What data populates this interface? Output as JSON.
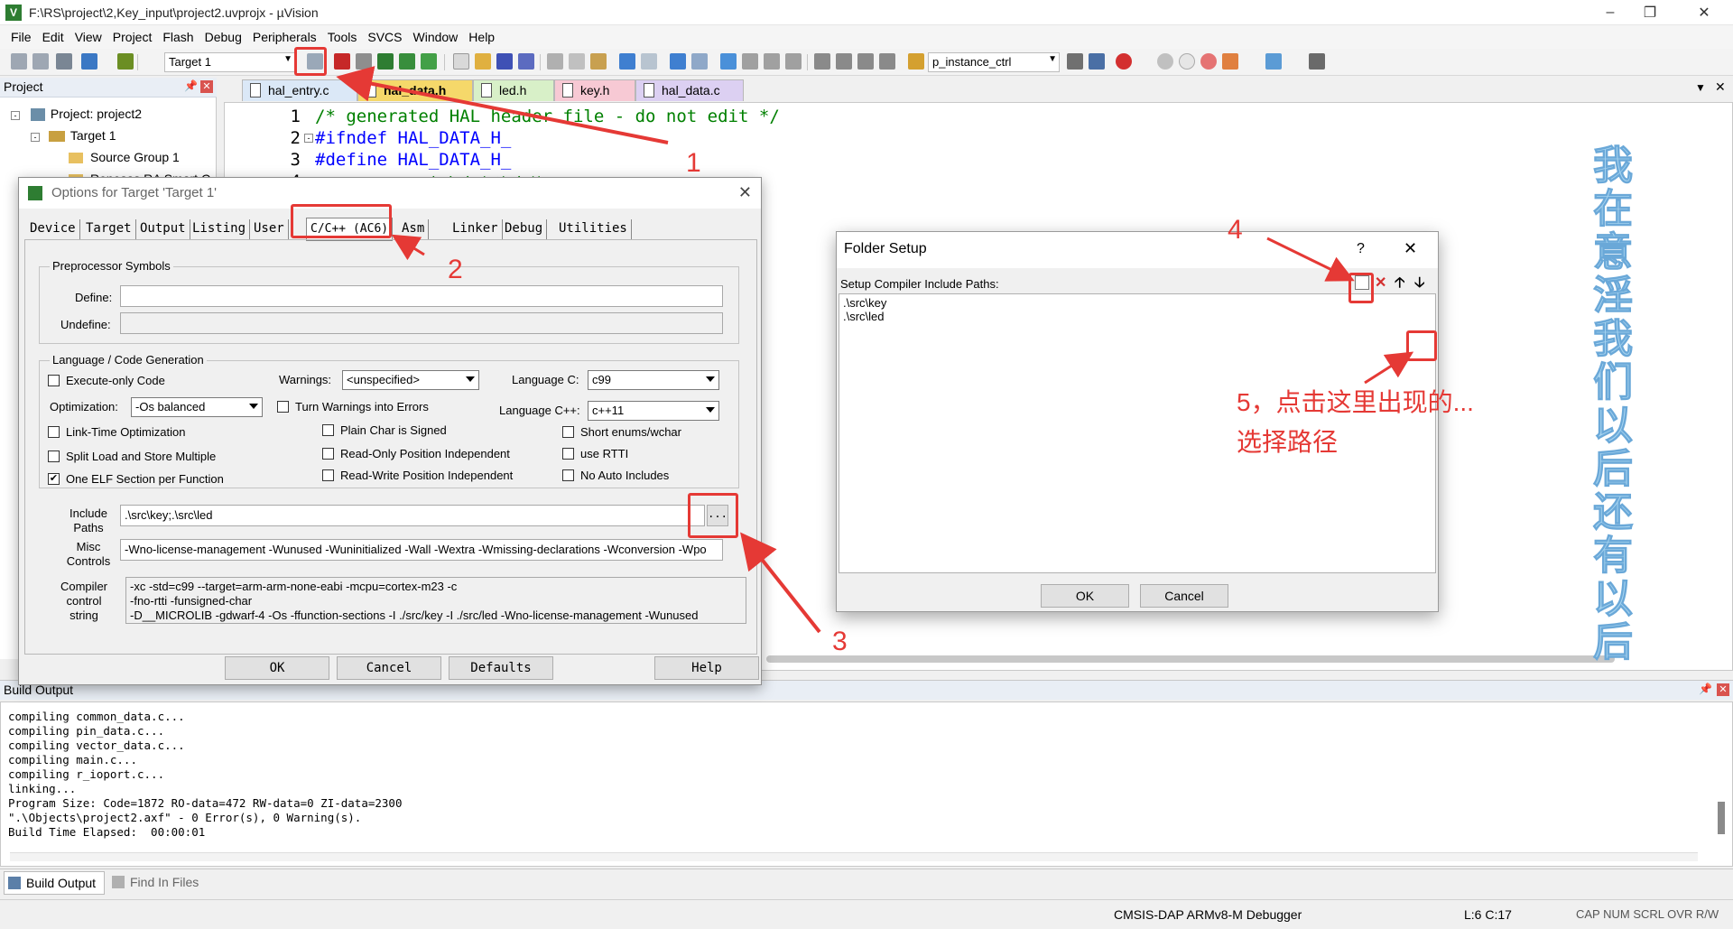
{
  "window": {
    "title": "F:\\RS\\project\\2,Key_input\\project2.uvprojx - µVision"
  },
  "menu": [
    "File",
    "Edit",
    "View",
    "Project",
    "Flash",
    "Debug",
    "Peripherals",
    "Tools",
    "SVCS",
    "Window",
    "Help"
  ],
  "toolbar": {
    "target": "Target 1",
    "function": "p_instance_ctrl"
  },
  "project_panel": {
    "header": "Project",
    "tree": [
      "Project: project2",
      "Target 1",
      "Source Group 1",
      "Renesas RA Smart C"
    ]
  },
  "editor": {
    "tabs": [
      "hal_entry.c",
      "hal_data.h",
      "led.h",
      "key.h",
      "hal_data.c"
    ],
    "lines": [
      {
        "n": "1",
        "text": "/* generated HAL header file - do not edit */"
      },
      {
        "n": "2",
        "text": "#ifndef HAL_DATA_H_"
      },
      {
        "n": "3",
        "text": "#define HAL_DATA_H_"
      },
      {
        "n": "4",
        "text": "/*****   用户自定义头文件      *****/"
      }
    ],
    "side_text": "我在意淫我们以后还有以后"
  },
  "options_dialog": {
    "title": "Options for Target 'Target 1'",
    "tabs": [
      "Device",
      "Target",
      "Output",
      "Listing",
      "User",
      "C/C++ (AC6)",
      "Asm",
      "Linker",
      "Debug",
      "Utilities"
    ],
    "preprocessor": {
      "group": "Preprocessor Symbols",
      "define_label": "Define:",
      "define_value": "",
      "undefine_label": "Undefine:"
    },
    "langgen": {
      "group": "Language / Code Generation",
      "execute_only": "Execute-only Code",
      "warnings_label": "Warnings:",
      "warnings_value": "<unspecified>",
      "language_c_label": "Language C:",
      "language_c_value": "c99",
      "optimization_label": "Optimization:",
      "optimization_value": "-Os balanced",
      "turn_warnings": "Turn Warnings into Errors",
      "language_cpp_label": "Language C++:",
      "language_cpp_value": "c++11",
      "lto": "Link-Time Optimization",
      "plain_char": "Plain Char is Signed",
      "short_enums": "Short enums/wchar",
      "split_load": "Split Load and Store Multiple",
      "ro_pos": "Read-Only Position Independent",
      "rtti": "use RTTI",
      "one_elf": "One ELF Section per Function",
      "rw_pos": "Read-Write Position Independent",
      "no_auto": "No Auto Includes"
    },
    "include_label_1": "Include",
    "include_label_2": "Paths",
    "include_value": ".\\src\\key;.\\src\\led",
    "browse": "...",
    "misc_label_1": "Misc",
    "misc_label_2": "Controls",
    "misc_value": "-Wno-license-management -Wunused -Wuninitialized -Wall -Wextra -Wmissing-declarations -Wconversion -Wpo",
    "compiler_label_1": "Compiler",
    "compiler_label_2": "control",
    "compiler_label_3": "string",
    "compiler_lines": [
      "-xc -std=c99 --target=arm-arm-none-eabi -mcpu=cortex-m23 -c",
      "-fno-rtti -funsigned-char",
      "-D__MICROLIB -gdwarf-4 -Os -ffunction-sections -I ./src/key -I ./src/led -Wno-license-management -Wunused"
    ],
    "buttons": {
      "ok": "OK",
      "cancel": "Cancel",
      "defaults": "Defaults",
      "help": "Help"
    }
  },
  "folder_dialog": {
    "title": "Folder Setup",
    "help": "?",
    "close": "✕",
    "label": "Setup Compiler Include Paths:",
    "paths": [
      ".\\src\\key",
      ".\\src\\led"
    ],
    "ok": "OK",
    "cancel": "Cancel"
  },
  "annotations": {
    "a1": "1",
    "a2": "2",
    "a3": "3",
    "a4": "4",
    "a5_line1": "5，点击这里出现的...",
    "a5_line2": "选择路径"
  },
  "build_output": {
    "header": "Build Output",
    "lines": [
      "compiling common_data.c...",
      "compiling pin_data.c...",
      "compiling vector_data.c...",
      "compiling main.c...",
      "compiling r_ioport.c...",
      "linking...",
      "Program Size: Code=1872 RO-data=472 RW-data=0 ZI-data=2300",
      "\".\\Objects\\project2.axf\" - 0 Error(s), 0 Warning(s).",
      "Build Time Elapsed:  00:00:01"
    ]
  },
  "bottom_tabs": [
    "Build Output",
    "Find In Files"
  ],
  "status": {
    "debugger": "CMSIS-DAP ARMv8-M Debugger",
    "pos": "L:6 C:17",
    "flags": "CAP NUM SCRL OVR R/W"
  },
  "colors": {
    "accent": "#e53935",
    "editor_comment": "#008000",
    "keyword": "#0000ff"
  }
}
